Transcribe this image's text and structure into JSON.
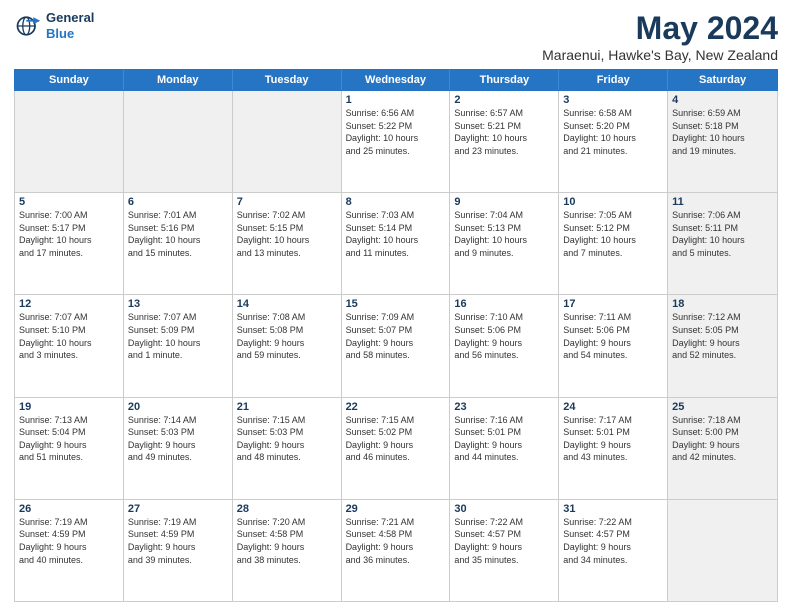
{
  "logo": {
    "line1": "General",
    "line2": "Blue"
  },
  "title": "May 2024",
  "subtitle": "Maraenui, Hawke's Bay, New Zealand",
  "headers": [
    "Sunday",
    "Monday",
    "Tuesday",
    "Wednesday",
    "Thursday",
    "Friday",
    "Saturday"
  ],
  "weeks": [
    [
      {
        "day": "",
        "text": "",
        "shaded": true
      },
      {
        "day": "",
        "text": "",
        "shaded": true
      },
      {
        "day": "",
        "text": "",
        "shaded": true
      },
      {
        "day": "1",
        "text": "Sunrise: 6:56 AM\nSunset: 5:22 PM\nDaylight: 10 hours\nand 25 minutes."
      },
      {
        "day": "2",
        "text": "Sunrise: 6:57 AM\nSunset: 5:21 PM\nDaylight: 10 hours\nand 23 minutes."
      },
      {
        "day": "3",
        "text": "Sunrise: 6:58 AM\nSunset: 5:20 PM\nDaylight: 10 hours\nand 21 minutes."
      },
      {
        "day": "4",
        "text": "Sunrise: 6:59 AM\nSunset: 5:18 PM\nDaylight: 10 hours\nand 19 minutes.",
        "shaded": true
      }
    ],
    [
      {
        "day": "5",
        "text": "Sunrise: 7:00 AM\nSunset: 5:17 PM\nDaylight: 10 hours\nand 17 minutes."
      },
      {
        "day": "6",
        "text": "Sunrise: 7:01 AM\nSunset: 5:16 PM\nDaylight: 10 hours\nand 15 minutes."
      },
      {
        "day": "7",
        "text": "Sunrise: 7:02 AM\nSunset: 5:15 PM\nDaylight: 10 hours\nand 13 minutes."
      },
      {
        "day": "8",
        "text": "Sunrise: 7:03 AM\nSunset: 5:14 PM\nDaylight: 10 hours\nand 11 minutes."
      },
      {
        "day": "9",
        "text": "Sunrise: 7:04 AM\nSunset: 5:13 PM\nDaylight: 10 hours\nand 9 minutes."
      },
      {
        "day": "10",
        "text": "Sunrise: 7:05 AM\nSunset: 5:12 PM\nDaylight: 10 hours\nand 7 minutes."
      },
      {
        "day": "11",
        "text": "Sunrise: 7:06 AM\nSunset: 5:11 PM\nDaylight: 10 hours\nand 5 minutes.",
        "shaded": true
      }
    ],
    [
      {
        "day": "12",
        "text": "Sunrise: 7:07 AM\nSunset: 5:10 PM\nDaylight: 10 hours\nand 3 minutes."
      },
      {
        "day": "13",
        "text": "Sunrise: 7:07 AM\nSunset: 5:09 PM\nDaylight: 10 hours\nand 1 minute."
      },
      {
        "day": "14",
        "text": "Sunrise: 7:08 AM\nSunset: 5:08 PM\nDaylight: 9 hours\nand 59 minutes."
      },
      {
        "day": "15",
        "text": "Sunrise: 7:09 AM\nSunset: 5:07 PM\nDaylight: 9 hours\nand 58 minutes."
      },
      {
        "day": "16",
        "text": "Sunrise: 7:10 AM\nSunset: 5:06 PM\nDaylight: 9 hours\nand 56 minutes."
      },
      {
        "day": "17",
        "text": "Sunrise: 7:11 AM\nSunset: 5:06 PM\nDaylight: 9 hours\nand 54 minutes."
      },
      {
        "day": "18",
        "text": "Sunrise: 7:12 AM\nSunset: 5:05 PM\nDaylight: 9 hours\nand 52 minutes.",
        "shaded": true
      }
    ],
    [
      {
        "day": "19",
        "text": "Sunrise: 7:13 AM\nSunset: 5:04 PM\nDaylight: 9 hours\nand 51 minutes."
      },
      {
        "day": "20",
        "text": "Sunrise: 7:14 AM\nSunset: 5:03 PM\nDaylight: 9 hours\nand 49 minutes."
      },
      {
        "day": "21",
        "text": "Sunrise: 7:15 AM\nSunset: 5:03 PM\nDaylight: 9 hours\nand 48 minutes."
      },
      {
        "day": "22",
        "text": "Sunrise: 7:15 AM\nSunset: 5:02 PM\nDaylight: 9 hours\nand 46 minutes."
      },
      {
        "day": "23",
        "text": "Sunrise: 7:16 AM\nSunset: 5:01 PM\nDaylight: 9 hours\nand 44 minutes."
      },
      {
        "day": "24",
        "text": "Sunrise: 7:17 AM\nSunset: 5:01 PM\nDaylight: 9 hours\nand 43 minutes."
      },
      {
        "day": "25",
        "text": "Sunrise: 7:18 AM\nSunset: 5:00 PM\nDaylight: 9 hours\nand 42 minutes.",
        "shaded": true
      }
    ],
    [
      {
        "day": "26",
        "text": "Sunrise: 7:19 AM\nSunset: 4:59 PM\nDaylight: 9 hours\nand 40 minutes."
      },
      {
        "day": "27",
        "text": "Sunrise: 7:19 AM\nSunset: 4:59 PM\nDaylight: 9 hours\nand 39 minutes."
      },
      {
        "day": "28",
        "text": "Sunrise: 7:20 AM\nSunset: 4:58 PM\nDaylight: 9 hours\nand 38 minutes."
      },
      {
        "day": "29",
        "text": "Sunrise: 7:21 AM\nSunset: 4:58 PM\nDaylight: 9 hours\nand 36 minutes."
      },
      {
        "day": "30",
        "text": "Sunrise: 7:22 AM\nSunset: 4:57 PM\nDaylight: 9 hours\nand 35 minutes."
      },
      {
        "day": "31",
        "text": "Sunrise: 7:22 AM\nSunset: 4:57 PM\nDaylight: 9 hours\nand 34 minutes."
      },
      {
        "day": "",
        "text": "",
        "shaded": true
      }
    ]
  ]
}
